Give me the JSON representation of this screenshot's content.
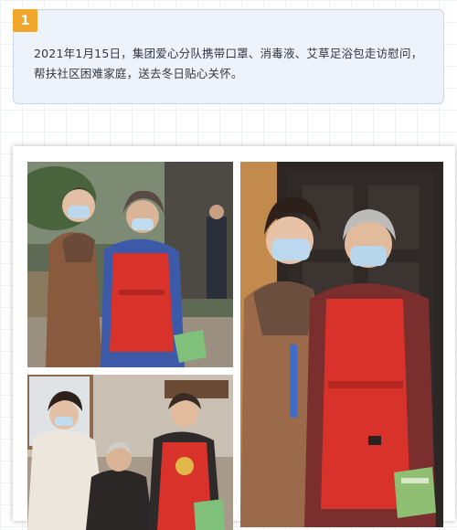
{
  "section": {
    "number": "1",
    "text": "2021年1月15日，集团爱心分队携带口罩、消毒液、艾草足浴包走访慰问，帮扶社区困难家庭，送去冬日贴心关怀。"
  },
  "photos": [
    {
      "id": "photo-visit-outdoor"
    },
    {
      "id": "photo-visit-doorway"
    },
    {
      "id": "photo-visit-indoor"
    }
  ],
  "colors": {
    "badge": "#f0a62a",
    "card_bg": "#eef3fb",
    "apron_red": "#d8322a"
  }
}
